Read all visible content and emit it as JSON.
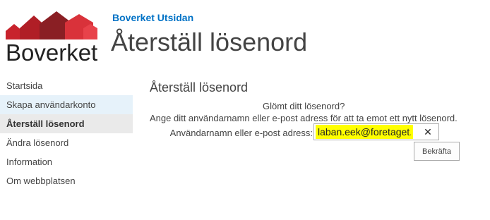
{
  "brand": {
    "logo_text": "Boverket",
    "logo_colors": [
      "#8a1f24",
      "#c8232c",
      "#e8424a"
    ]
  },
  "header": {
    "site_title": "Boverket Utsidan",
    "page_title": "Återställ lösenord"
  },
  "sidebar": {
    "items": [
      {
        "label": "Startsida"
      },
      {
        "label": "Skapa användarkonto"
      },
      {
        "label": "Återställ lösenord"
      },
      {
        "label": "Ändra lösenord"
      },
      {
        "label": "Information"
      },
      {
        "label": "Om webbplatsen"
      }
    ]
  },
  "main": {
    "title": "Återställ lösenord",
    "line1": "Glömt ditt lösenord?",
    "line2": "Ange ditt användarnamn eller e-post adress för att ta emot ett nytt lösenord.",
    "field_label": "Användarnamn eller e-post adress:",
    "field_value": "laban.eek@foretaget.se",
    "clear_glyph": "✕",
    "confirm_label": "Bekräfta"
  }
}
